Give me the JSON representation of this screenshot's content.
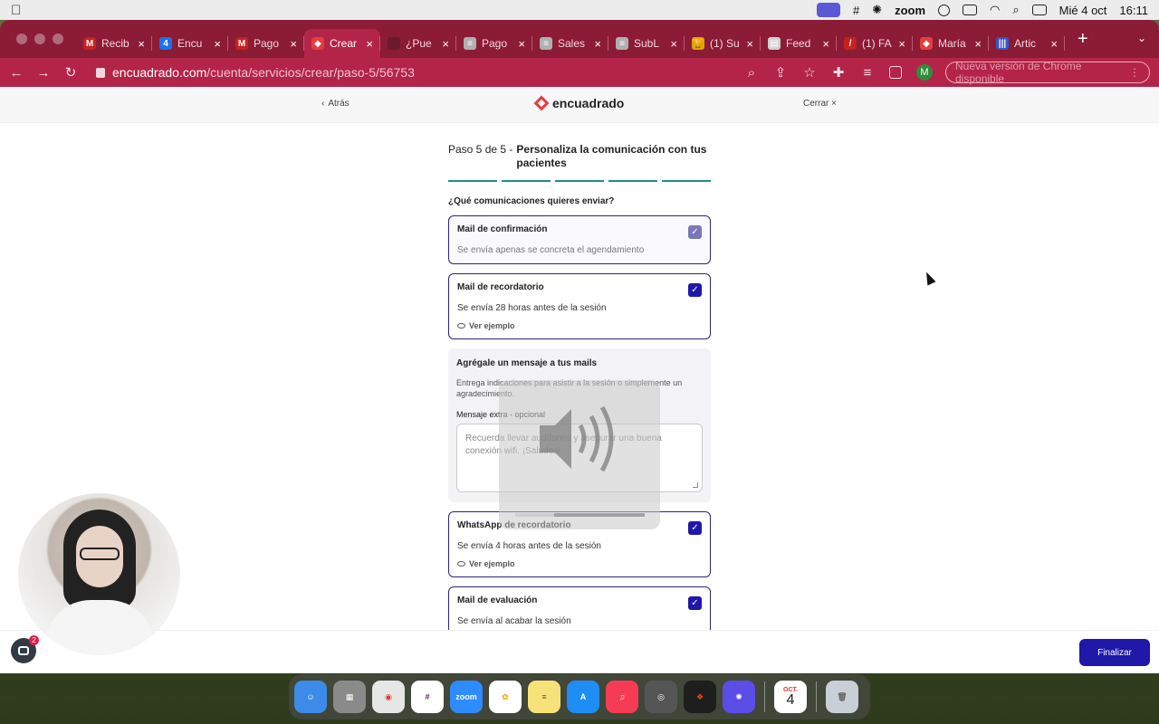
{
  "menubar": {
    "date": "Mié 4 oct",
    "time": "16:11",
    "zoom_label": "zoom"
  },
  "tabs": [
    {
      "label": "Recib",
      "fav_color": "#c5221f",
      "fav_glyph": "M"
    },
    {
      "label": "Encu",
      "fav_color": "#1a73e8",
      "fav_glyph": "4"
    },
    {
      "label": "Pago",
      "fav_color": "#c5221f",
      "fav_glyph": "M"
    },
    {
      "label": "Crear",
      "fav_color": "#e53d3d",
      "fav_glyph": "◆",
      "active": true
    },
    {
      "label": "¿Pue",
      "fav_color": "#6a1a2c",
      "fav_glyph": ""
    },
    {
      "label": "Pago",
      "fav_color": "#b0b0b0",
      "fav_glyph": "≡"
    },
    {
      "label": "Sales",
      "fav_color": "#b0b0b0",
      "fav_glyph": "≡"
    },
    {
      "label": "SubL",
      "fav_color": "#b0b0b0",
      "fav_glyph": "≡"
    },
    {
      "label": "(1) Su",
      "fav_color": "#e2a400",
      "fav_glyph": "🏆"
    },
    {
      "label": "Feed",
      "fav_color": "#d0d0d0",
      "fav_glyph": "▤"
    },
    {
      "label": "(1) FA",
      "fav_color": "#c5221f",
      "fav_glyph": "/"
    },
    {
      "label": "María",
      "fav_color": "#e53d3d",
      "fav_glyph": "◆"
    },
    {
      "label": "Artic",
      "fav_color": "#3a54c9",
      "fav_glyph": "|||"
    }
  ],
  "address": {
    "host": "encuadrado.com",
    "path": "/cuenta/servicios/crear/paso-5/56753"
  },
  "profile_initial": "M",
  "update_notice": "Nueva versión de Chrome disponible",
  "header": {
    "back_label": "Atrás",
    "logo_text": "encuadrado",
    "close_label": "Cerrar"
  },
  "wizard": {
    "step_prefix": "Paso 5 de 5 -",
    "step_title": "Personaliza la comunicación con tus pacientes",
    "question": "¿Qué comunicaciones quieres enviar?"
  },
  "cards": {
    "confirm": {
      "title": "Mail de confirmación",
      "desc": "Se envía apenas se concreta el agendamiento"
    },
    "reminder": {
      "title": "Mail de recordatorio",
      "desc": "Se envía 28 horas antes de la sesión",
      "example": "Ver ejemplo"
    },
    "whatsapp": {
      "title": "WhatsApp de recordatorio",
      "desc": "Se envía 4 horas antes de la sesión",
      "example": "Ver ejemplo"
    },
    "evaluation": {
      "title": "Mail de evaluación",
      "desc": "Se envía al acabar la sesión"
    }
  },
  "extra_message": {
    "title": "Agrégale un mensaje a tus mails",
    "desc": "Entrega indicaciones para asistir a la sesión o simplemente un agradecimiento.",
    "label": "Mensaje extra - opcional",
    "placeholder": "Recuerda llevar audífonos y asegurar una buena conexión wifi. ¡Saludos!"
  },
  "footer": {
    "finish_label": "Finalizar"
  },
  "chat_badge_count": "2",
  "dock": {
    "zoom_label": "zoom",
    "calendar_month": "OCT.",
    "calendar_day": "4"
  }
}
